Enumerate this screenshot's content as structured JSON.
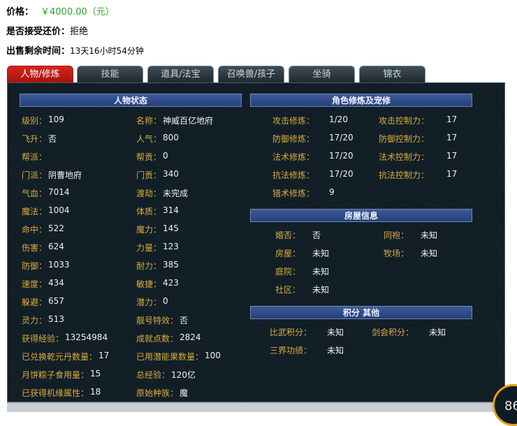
{
  "listing": {
    "price_label": "价格：",
    "price_value": "￥4000.00（元）",
    "bargain_label": "是否接受还价：",
    "bargain_value": "拒绝",
    "time_label": "出售剩余时间：",
    "time_value": "13天16小时54分钟"
  },
  "tabs": [
    "人物/修炼",
    "技能",
    "道具/法宝",
    "召唤兽/孩子",
    "坐骑",
    "锦衣"
  ],
  "active_tab": 0,
  "character": {
    "header": "人物状态",
    "rows": [
      [
        "级别：",
        "109",
        "名称：",
        "神威百亿地府"
      ],
      [
        "飞升：",
        "否",
        "人气：",
        "800"
      ],
      [
        "帮派：",
        "",
        "帮贡：",
        "0"
      ],
      [
        "门派：",
        "阴曹地府",
        "门贡：",
        "340"
      ],
      [
        "气血：",
        "7014",
        "渡劫：",
        "未完成"
      ],
      [
        "魔法：",
        "1004",
        "体质：",
        "314"
      ],
      [
        "命中：",
        "522",
        "魔力：",
        "145"
      ],
      [
        "伤害：",
        "624",
        "力量：",
        "123"
      ],
      [
        "防御：",
        "1033",
        "耐力：",
        "385"
      ],
      [
        "速度：",
        "434",
        "敏捷：",
        "423"
      ],
      [
        "躲避：",
        "657",
        "潜力：",
        "0"
      ],
      [
        "灵力：",
        "513",
        "靓号特效：",
        "否"
      ],
      [
        "获得经验：",
        "13254984",
        "成就点数：",
        "2824"
      ],
      [
        "已兑换乾元丹数量：",
        "17",
        "已用潜能果数量：",
        "100"
      ],
      [
        "月饼粽子食用量：",
        "15",
        "总经验：",
        "120亿"
      ],
      [
        "已获得机缘属性：",
        "18",
        "原始种族：",
        "魔"
      ]
    ]
  },
  "cultivation": {
    "header": "角色修炼及宠修",
    "rows": [
      [
        "攻击修炼：",
        "1/20",
        "攻击控制力：",
        "17"
      ],
      [
        "防御修炼：",
        "17/20",
        "防御控制力：",
        "17"
      ],
      [
        "法术修炼：",
        "17/20",
        "法术控制力：",
        "17"
      ],
      [
        "抗法修炼：",
        "17/20",
        "抗法控制力：",
        "17"
      ],
      [
        "猎术修炼：",
        "9",
        "",
        ""
      ]
    ]
  },
  "house": {
    "header": "房屋信息",
    "rows": [
      [
        "婚否：",
        "否",
        "同袍：",
        "未知"
      ],
      [
        "房屋：",
        "未知",
        "牧场：",
        "未知"
      ],
      [
        "庭院：",
        "未知",
        "",
        ""
      ],
      [
        "社区：",
        "未知",
        "",
        ""
      ]
    ]
  },
  "points": {
    "header": "积分 其他",
    "rows": [
      [
        "比武积分：",
        "未知",
        "剑会积分：",
        "未知"
      ],
      [
        "三界功绩：",
        "未知",
        "",
        ""
      ]
    ]
  },
  "badge_text": "86",
  "colors": {
    "price": "#2aa52a",
    "label_gold": "#d9ac3d",
    "value_white": "#f1f1f1",
    "active_tab": "#c81a14",
    "section_header": "#2f4c8c"
  }
}
